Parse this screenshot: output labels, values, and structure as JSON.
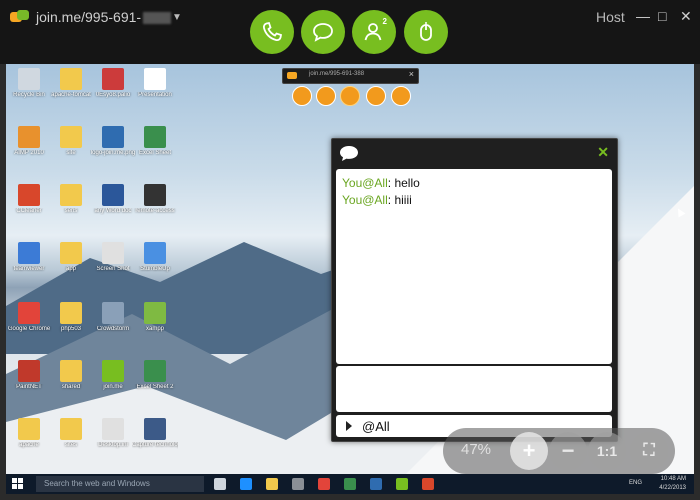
{
  "window": {
    "session_id": "join.me/995-691-",
    "role": "Host",
    "controls": {
      "minimize": "—",
      "maximize": "□",
      "close": "✕"
    }
  },
  "toolbar": {
    "buttons": [
      {
        "name": "call",
        "icon": "phone-icon"
      },
      {
        "name": "chat",
        "icon": "chat-bubble-icon"
      },
      {
        "name": "participants",
        "icon": "person-icon",
        "badge": "2"
      },
      {
        "name": "remote-control",
        "icon": "mouse-icon"
      }
    ],
    "accent": "#78be20"
  },
  "mini_toolbar": {
    "title": "join.me/995-691-388",
    "accent": "#f29a1d"
  },
  "desktop_icons": [
    {
      "label": "Recycle Bin",
      "color": "#d0d8e0"
    },
    {
      "label": "apache-tomcat",
      "color": "#f2c94c"
    },
    {
      "label": "0Esyo8.palio",
      "color": "#cc3b3b"
    },
    {
      "label": "Presentation",
      "color": "#ffffff"
    },
    {
      "label": "AIMP 2010",
      "color": "#e8912d"
    },
    {
      "label": "site",
      "color": "#f2c94c"
    },
    {
      "label": "logo-join.me.png",
      "color": "#2f6cb0"
    },
    {
      "label": "Excel Sheet",
      "color": "#3a8f4d"
    },
    {
      "label": "CCleaner",
      "color": "#d8472b"
    },
    {
      "label": "sens",
      "color": "#f2c94c"
    },
    {
      "label": "any Word doc",
      "color": "#2b579a"
    },
    {
      "label": "remote-access",
      "color": "#333333"
    },
    {
      "label": "teamviewer",
      "color": "#3c7bd6"
    },
    {
      "label": "app",
      "color": "#f2c94c"
    },
    {
      "label": "Screen Shot",
      "color": "#e0e0e0"
    },
    {
      "label": "StumbleUp",
      "color": "#4a90e2"
    },
    {
      "label": "Google Chrome",
      "color": "#e2443a"
    },
    {
      "label": "php503",
      "color": "#f2c94c"
    },
    {
      "label": "Crowdstorm",
      "color": "#8aa0b8"
    },
    {
      "label": "xampp",
      "color": "#7fba42"
    },
    {
      "label": "PaintNET",
      "color": "#c0392b"
    },
    {
      "label": "shared",
      "color": "#f2c94c"
    },
    {
      "label": "join.me",
      "color": "#78be20"
    },
    {
      "label": "Excel Sheet 2",
      "color": "#3a8f4d"
    },
    {
      "label": "apache",
      "color": "#f2c94c"
    },
    {
      "label": "sites",
      "color": "#f2c94c"
    },
    {
      "label": "Desktop.ini",
      "color": "#e0e0e0"
    },
    {
      "label": "Capture technologies",
      "color": "#3c5a88"
    }
  ],
  "chat": {
    "messages": [
      {
        "sender": "You@All",
        "text": "hello"
      },
      {
        "sender": "You@All",
        "text": "hiiii"
      }
    ],
    "recipient": "@All",
    "close_label": "✕"
  },
  "zoom": {
    "percent": "47%",
    "plus": "+",
    "minus": "−",
    "actual_size": "1:1",
    "fit": "⛶"
  },
  "taskbar": {
    "search_placeholder": "Search the web and Windows",
    "language": "ENG",
    "time": "10:48 AM",
    "date": "4/22/2013"
  }
}
